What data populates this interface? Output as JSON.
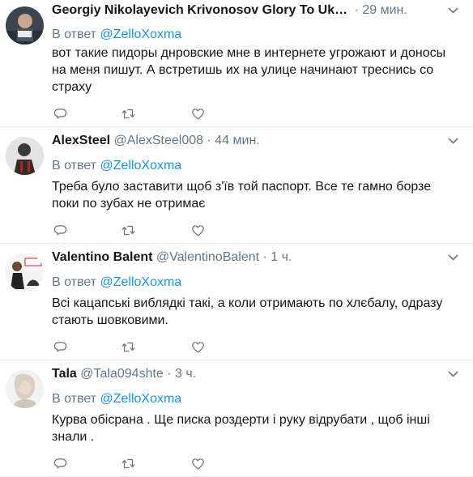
{
  "colors": {
    "link": "#1b95e0",
    "meta": "#657786",
    "text": "#14171a",
    "divider": "#e6ecf0"
  },
  "tweets": [
    {
      "name": "Georgiy Nikolayevich Krivonosov Glory To Uk…",
      "handle": "",
      "dot": "·",
      "time": "29 мин.",
      "reply_prefix": "В ответ",
      "mention": "@ZelloXoxma",
      "text": "вот такие пидоры днровские мне в интернете угрожают и доносы на меня пишут. А встретишь их на улице начинают треснись со страху"
    },
    {
      "name": "AlexSteel",
      "handle": "@AlexSteel008",
      "dot": "·",
      "time": "44 мин.",
      "reply_prefix": "В ответ",
      "mention": "@ZelloXoxma",
      "text": "Треба було заставити щоб з'їв той паспорт. Все те гамно борзе поки по зубах не отримає"
    },
    {
      "name": "Valentino Balent",
      "handle": "@ValentinoBalent",
      "dot": "·",
      "time": "1 ч.",
      "reply_prefix": "В ответ",
      "mention": "@ZelloXoxma",
      "text": "Всі кацапські виблядкі такі, а коли отримають по хлєбалу, одразу стають шовковими."
    },
    {
      "name": "Tala",
      "handle": "@Tala094shte",
      "dot": "·",
      "time": "3 ч.",
      "reply_prefix": "В ответ",
      "mention": "@ZelloXoxma",
      "text": "Курва обісрана . Ще писка роздерти і руку відрубати , щоб інші знали ."
    }
  ]
}
